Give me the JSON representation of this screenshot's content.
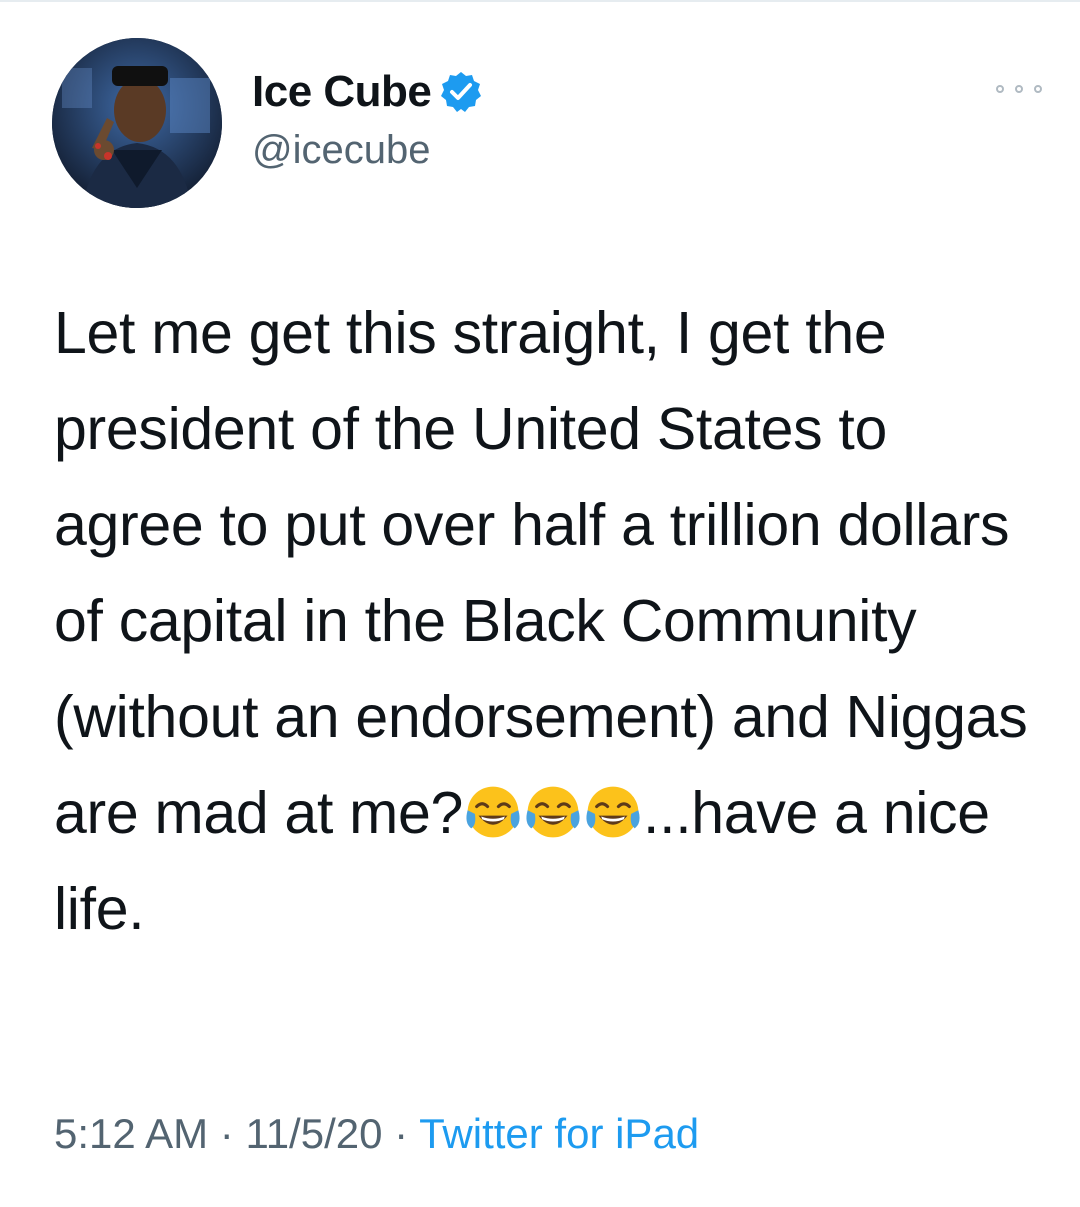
{
  "tweet": {
    "author": {
      "display_name": "Ice Cube",
      "handle": "@icecube",
      "verified": true,
      "avatar_icon": "profile-photo"
    },
    "more_icon": "more-dots-icon",
    "text_segments": [
      "Let me get this straight, I get the president of the United States to agree to put over half a trillion dollars of capital in the Black Community (without an endorsement) and Niggas are mad at me?",
      "...have a nice life."
    ],
    "emoji": {
      "name": "face-with-tears-of-joy-emoji",
      "count": 3
    },
    "meta": {
      "time": "5:12 AM",
      "separator": "·",
      "date": "11/5/20",
      "source": "Twitter for iPad"
    },
    "colors": {
      "text": "#0f1419",
      "secondary": "#536471",
      "link": "#1d9bf0",
      "verified": "#1d9bf0"
    }
  }
}
